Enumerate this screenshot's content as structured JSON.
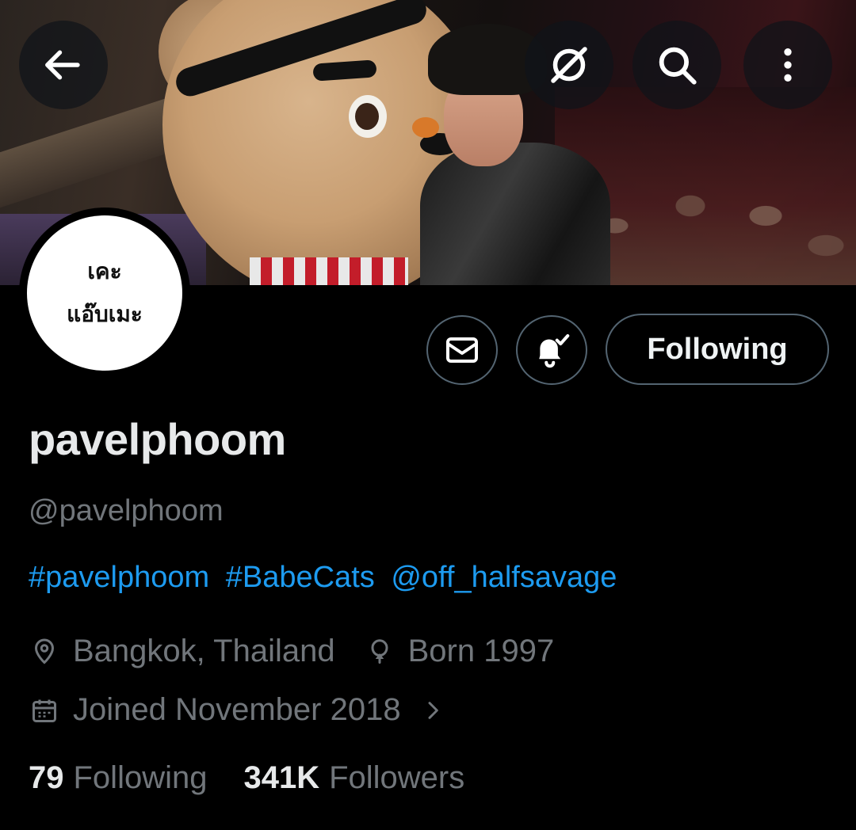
{
  "header": {
    "back_icon": "arrow-left-icon",
    "grok_icon": "slashed-circle-icon",
    "search_icon": "search-icon",
    "more_icon": "more-vertical-icon"
  },
  "avatar": {
    "line1": "เคะ",
    "line2": "แอ๊บเมะ"
  },
  "actions": {
    "message_icon": "mail-icon",
    "notify_icon": "bell-check-icon",
    "follow_label": "Following"
  },
  "profile": {
    "display_name": "pavelphoom",
    "handle": "@pavelphoom",
    "bio": {
      "tag1": "#pavelphoom",
      "tag2": "#BabeCats",
      "mention": "@off_halfsavage"
    },
    "location": "Bangkok, Thailand",
    "born": "Born 1997",
    "joined": "Joined November 2018"
  },
  "stats": {
    "following_count": "79",
    "following_label": "Following",
    "followers_count": "341K",
    "followers_label": "Followers"
  },
  "colors": {
    "background": "#000000",
    "link": "#1d9bf0",
    "muted": "#71767b",
    "border": "#536471"
  }
}
